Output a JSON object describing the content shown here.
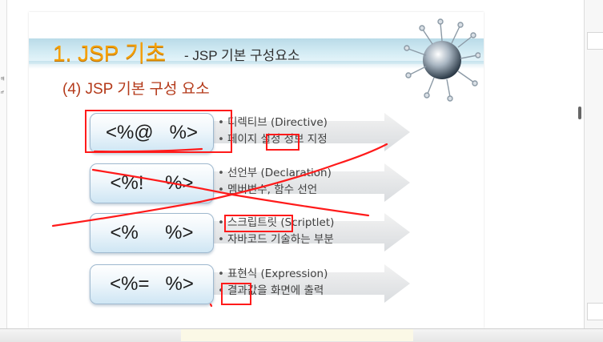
{
  "slide": {
    "title_main": "1. JSP 기초",
    "title_sub": "- JSP 기본 구성요소",
    "subtitle": "(4) JSP 기본 구성 요소",
    "rows": [
      {
        "tag": "<%@   %>",
        "line1": "디렉티브 (Directive)",
        "line2": "페이지 설정 정보 지정"
      },
      {
        "tag": "<%!    %>",
        "line1": "선언부 (Declaration)",
        "line2": "멤버변수, 함수 선언"
      },
      {
        "tag": "<%     %>",
        "line1": "스크립트릿 (Scriptlet)",
        "line2": "자바코드 기술하는 부분"
      },
      {
        "tag": "<%=   %>",
        "line1": "표현식 (Expression)",
        "line2": "결과값을 화면에 출력"
      }
    ]
  },
  "left_panel": {
    "ticks": [
      "에",
      "rf"
    ]
  },
  "colors": {
    "title_orange": "#f6a000",
    "subtitle_red": "#b43a1a",
    "annotation_red": "#ff1a1a"
  }
}
